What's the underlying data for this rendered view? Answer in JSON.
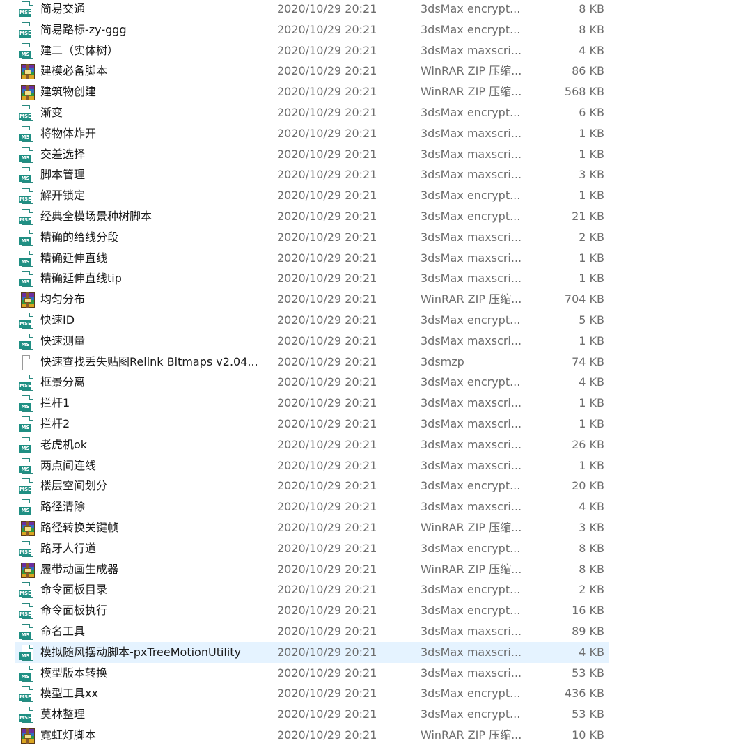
{
  "files": [
    {
      "name": "简易交通",
      "date": "2020/10/29 20:21",
      "type": "3dsMax encrypt...",
      "size": "8 KB",
      "icon": "mse"
    },
    {
      "name": "简易路标-zy-ggg",
      "date": "2020/10/29 20:21",
      "type": "3dsMax encrypt...",
      "size": "8 KB",
      "icon": "mse"
    },
    {
      "name": "建二（实体树）",
      "date": "2020/10/29 20:21",
      "type": "3dsMax maxscri...",
      "size": "4 KB",
      "icon": "ms"
    },
    {
      "name": "建模必备脚本",
      "date": "2020/10/29 20:21",
      "type": "WinRAR ZIP 压缩...",
      "size": "86 KB",
      "icon": "zip"
    },
    {
      "name": "建筑物创建",
      "date": "2020/10/29 20:21",
      "type": "WinRAR ZIP 压缩...",
      "size": "568 KB",
      "icon": "zip"
    },
    {
      "name": "渐变",
      "date": "2020/10/29 20:21",
      "type": "3dsMax encrypt...",
      "size": "6 KB",
      "icon": "mse"
    },
    {
      "name": "将物体炸开",
      "date": "2020/10/29 20:21",
      "type": "3dsMax maxscri...",
      "size": "1 KB",
      "icon": "ms"
    },
    {
      "name": "交差选择",
      "date": "2020/10/29 20:21",
      "type": "3dsMax maxscri...",
      "size": "1 KB",
      "icon": "ms"
    },
    {
      "name": "脚本管理",
      "date": "2020/10/29 20:21",
      "type": "3dsMax maxscri...",
      "size": "3 KB",
      "icon": "ms"
    },
    {
      "name": "解开锁定",
      "date": "2020/10/29 20:21",
      "type": "3dsMax encrypt...",
      "size": "1 KB",
      "icon": "mse"
    },
    {
      "name": "经典全模场景种树脚本",
      "date": "2020/10/29 20:21",
      "type": "3dsMax encrypt...",
      "size": "21 KB",
      "icon": "mse"
    },
    {
      "name": "精确的给线分段",
      "date": "2020/10/29 20:21",
      "type": "3dsMax maxscri...",
      "size": "2 KB",
      "icon": "ms"
    },
    {
      "name": "精确延伸直线",
      "date": "2020/10/29 20:21",
      "type": "3dsMax maxscri...",
      "size": "1 KB",
      "icon": "ms"
    },
    {
      "name": "精确延伸直线tip",
      "date": "2020/10/29 20:21",
      "type": "3dsMax maxscri...",
      "size": "1 KB",
      "icon": "ms"
    },
    {
      "name": "均匀分布",
      "date": "2020/10/29 20:21",
      "type": "WinRAR ZIP 压缩...",
      "size": "704 KB",
      "icon": "zip"
    },
    {
      "name": "快速ID",
      "date": "2020/10/29 20:21",
      "type": "3dsMax encrypt...",
      "size": "5 KB",
      "icon": "mse"
    },
    {
      "name": "快速测量",
      "date": "2020/10/29 20:21",
      "type": "3dsMax maxscri...",
      "size": "1 KB",
      "icon": "ms"
    },
    {
      "name": "快速查找丢失贴图Relink Bitmaps v2.04...",
      "date": "2020/10/29 20:21",
      "type": "3dsmzp",
      "size": "74 KB",
      "icon": "blank"
    },
    {
      "name": "框景分离",
      "date": "2020/10/29 20:21",
      "type": "3dsMax encrypt...",
      "size": "4 KB",
      "icon": "mse"
    },
    {
      "name": "拦杆1",
      "date": "2020/10/29 20:21",
      "type": "3dsMax maxscri...",
      "size": "1 KB",
      "icon": "ms"
    },
    {
      "name": "拦杆2",
      "date": "2020/10/29 20:21",
      "type": "3dsMax maxscri...",
      "size": "1 KB",
      "icon": "ms"
    },
    {
      "name": "老虎机ok",
      "date": "2020/10/29 20:21",
      "type": "3dsMax maxscri...",
      "size": "26 KB",
      "icon": "ms"
    },
    {
      "name": "两点间连线",
      "date": "2020/10/29 20:21",
      "type": "3dsMax maxscri...",
      "size": "1 KB",
      "icon": "ms"
    },
    {
      "name": "楼层空间划分",
      "date": "2020/10/29 20:21",
      "type": "3dsMax encrypt...",
      "size": "20 KB",
      "icon": "mse"
    },
    {
      "name": "路径清除",
      "date": "2020/10/29 20:21",
      "type": "3dsMax maxscri...",
      "size": "4 KB",
      "icon": "ms"
    },
    {
      "name": "路径转换关键帧",
      "date": "2020/10/29 20:21",
      "type": "WinRAR ZIP 压缩...",
      "size": "3 KB",
      "icon": "zip"
    },
    {
      "name": "路牙人行道",
      "date": "2020/10/29 20:21",
      "type": "3dsMax encrypt...",
      "size": "8 KB",
      "icon": "mse"
    },
    {
      "name": "履带动画生成器",
      "date": "2020/10/29 20:21",
      "type": "WinRAR ZIP 压缩...",
      "size": "8 KB",
      "icon": "zip"
    },
    {
      "name": "命令面板目录",
      "date": "2020/10/29 20:21",
      "type": "3dsMax encrypt...",
      "size": "2 KB",
      "icon": "mse"
    },
    {
      "name": "命令面板执行",
      "date": "2020/10/29 20:21",
      "type": "3dsMax encrypt...",
      "size": "16 KB",
      "icon": "mse"
    },
    {
      "name": "命名工具",
      "date": "2020/10/29 20:21",
      "type": "3dsMax maxscri...",
      "size": "89 KB",
      "icon": "ms"
    },
    {
      "name": "模拟随风摆动脚本-pxTreeMotionUtility",
      "date": "2020/10/29 20:21",
      "type": "3dsMax maxscri...",
      "size": "4 KB",
      "icon": "ms",
      "selected": true
    },
    {
      "name": "模型版本转换",
      "date": "2020/10/29 20:21",
      "type": "3dsMax maxscri...",
      "size": "53 KB",
      "icon": "ms"
    },
    {
      "name": "模型工具xx",
      "date": "2020/10/29 20:21",
      "type": "3dsMax encrypt...",
      "size": "436 KB",
      "icon": "mse"
    },
    {
      "name": "莫林整理",
      "date": "2020/10/29 20:21",
      "type": "3dsMax encrypt...",
      "size": "53 KB",
      "icon": "mse"
    },
    {
      "name": "霓虹灯脚本",
      "date": "2020/10/29 20:21",
      "type": "WinRAR ZIP 压缩...",
      "size": "10 KB",
      "icon": "zip"
    }
  ],
  "badges": {
    "mse": "MSE",
    "ms": "MS"
  }
}
